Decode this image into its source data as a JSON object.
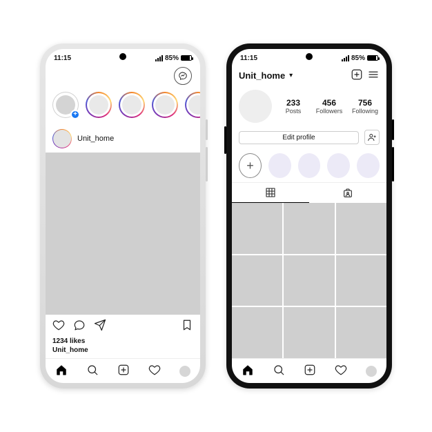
{
  "status": {
    "time": "11:15",
    "battery_pct": "85%"
  },
  "feed": {
    "username": "Unit_home",
    "likes_label": "1234 likes",
    "post_username": "Unit_home"
  },
  "profile": {
    "username": "Unit_home",
    "stats": {
      "posts": {
        "count": "233",
        "label": "Posts"
      },
      "followers": {
        "count": "456",
        "label": "Followers"
      },
      "following": {
        "count": "756",
        "label": "Following"
      }
    },
    "edit_label": "Edit profile"
  }
}
